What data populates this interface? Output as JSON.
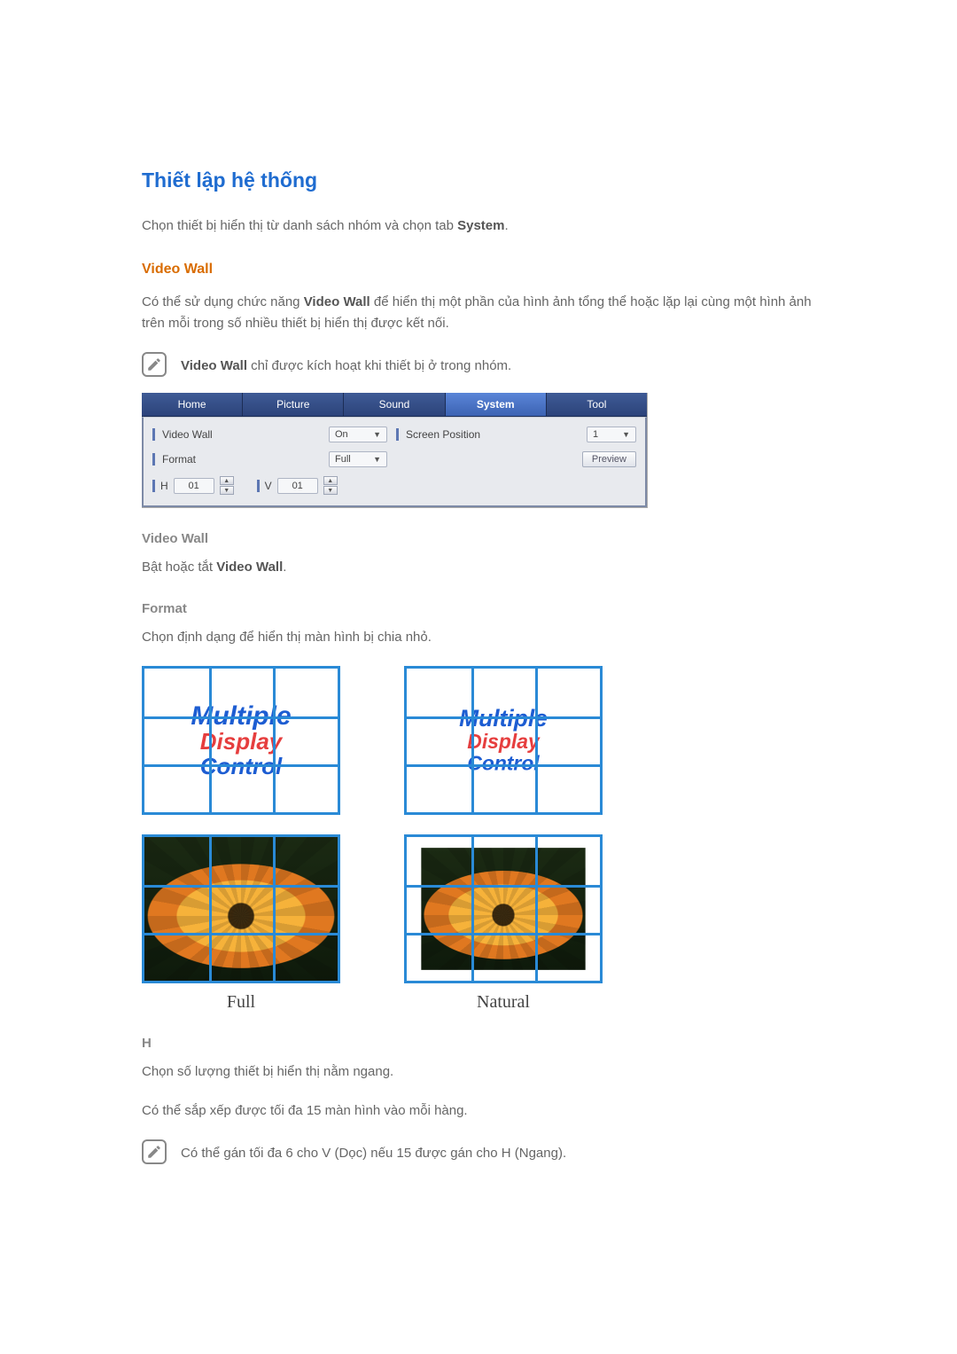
{
  "section": {
    "title": "Thiết lập hệ thống",
    "intro_before": "Chọn thiết bị hiển thị từ danh sách nhóm và chọn tab ",
    "intro_bold": "System",
    "intro_after": "."
  },
  "video_wall": {
    "heading": "Video Wall",
    "desc_before": "Có thể sử dụng chức năng ",
    "desc_bold": "Video Wall",
    "desc_after": " để hiển thị một phần của hình ảnh tổng thể hoặc lặp lại cùng một hình ảnh trên mỗi trong số nhiều thiết bị hiển thị được kết nối.",
    "note_bold": "Video Wall",
    "note_after": " chỉ được kích hoạt khi thiết bị ở trong nhóm.",
    "field_title": "Video Wall",
    "toggle_before": "Bật hoặc tắt ",
    "toggle_bold": "Video Wall",
    "toggle_after": ".",
    "format_title": "Format",
    "format_desc": "Chọn định dạng để hiển thị màn hình bị chia nhỏ.",
    "illus_text1": "Multiple",
    "illus_text2": "Display",
    "illus_text3": "Control",
    "label_full": "Full",
    "label_natural": "Natural",
    "h_title": "H",
    "h_desc1": "Chọn số lượng thiết bị hiển thị nằm ngang.",
    "h_desc2": "Có thể sắp xếp được tối đa 15 màn hình vào mỗi hàng.",
    "h_note": "Có thể gán tối đa 6 cho V (Dọc) nếu 15 được gán cho H (Ngang)."
  },
  "panel": {
    "tabs": {
      "home": "Home",
      "picture": "Picture",
      "sound": "Sound",
      "system": "System",
      "tool": "Tool"
    },
    "field_video_wall": "Video Wall",
    "value_on": "On",
    "field_screen_position": "Screen Position",
    "value_screen_position": "1",
    "field_format": "Format",
    "value_format": "Full",
    "preview": "Preview",
    "h_label": "H",
    "h_value": "01",
    "v_label": "V",
    "v_value": "01"
  }
}
